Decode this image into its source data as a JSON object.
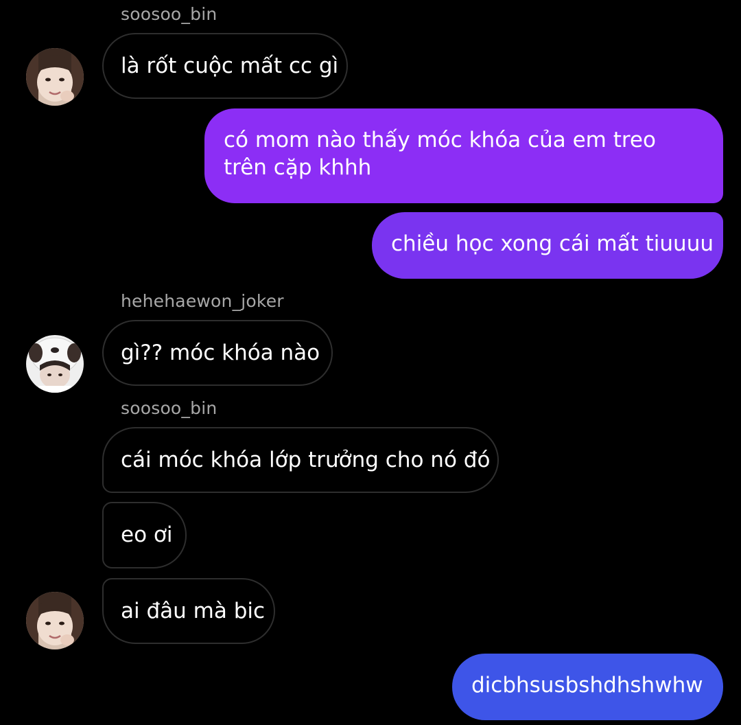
{
  "messages": [
    {
      "id": "m1",
      "direction": "incoming",
      "sender": "soosoo_bin",
      "text": "là rốt cuộc mất cc gì"
    },
    {
      "id": "m2",
      "direction": "outgoing",
      "text": "có mom nào thấy móc khóa của em treo trên cặp khhh"
    },
    {
      "id": "m3",
      "direction": "outgoing",
      "text": "chiều học xong cái mất tiuuuu"
    },
    {
      "id": "m4",
      "direction": "incoming",
      "sender": "hehehaewon_joker",
      "text": "gì?? móc khóa nào"
    },
    {
      "id": "m5",
      "direction": "incoming",
      "sender": "soosoo_bin",
      "text": "cái móc khóa lớp trưởng cho nó đó"
    },
    {
      "id": "m6",
      "direction": "incoming",
      "sender": "soosoo_bin",
      "text": "eo ơi"
    },
    {
      "id": "m7",
      "direction": "incoming",
      "sender": "soosoo_bin",
      "text": "ai đâu mà bic"
    },
    {
      "id": "m8",
      "direction": "outgoing",
      "text": "dicbhsusbshdhshwhw"
    }
  ],
  "senders": {
    "s1": "soosoo_bin",
    "s2": "hehehaewon_joker",
    "s3": "soosoo_bin"
  },
  "colors": {
    "background": "#000000",
    "incoming_border": "#2e2e2e",
    "sender_label": "#a8a8a8",
    "outgoing_top": "#8c2ef5",
    "outgoing_mid": "#7a34f0",
    "outgoing_bottom": "#3e55e8"
  }
}
